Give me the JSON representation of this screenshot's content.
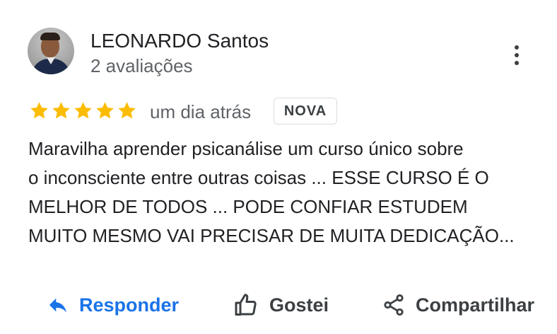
{
  "reviewer": {
    "name": "LEONARDO Santos",
    "review_count": "2 avaliações"
  },
  "rating": {
    "stars": 5,
    "max": 5,
    "color": "#fbbc04"
  },
  "review": {
    "date": "um dia atrás",
    "badge": "NOVA",
    "lines": [
      "Maravilha aprender psicanálise um curso único sobre",
      "o inconsciente entre outras coisas ... ESSE CURSO É O",
      "MELHOR DE TODOS ...  PODE CONFIAR ESTUDEM",
      "MUITO MESMO VAI PRECISAR DE MUITA DEDICAÇÃO..."
    ]
  },
  "actions": {
    "reply": {
      "label": "Responder",
      "icon": "reply-icon",
      "color": "#1a73e8"
    },
    "like": {
      "label": "Gostei",
      "icon": "thumbs-up-icon"
    },
    "share": {
      "label": "Compartilhar",
      "icon": "share-icon"
    }
  },
  "menu": {
    "icon": "more-vert-icon"
  }
}
